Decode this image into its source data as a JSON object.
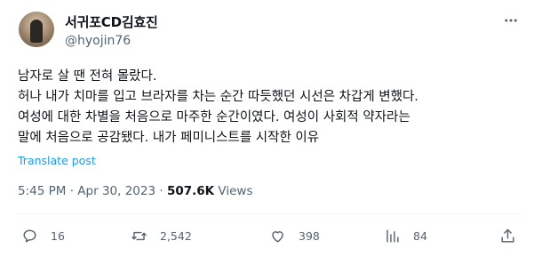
{
  "author": {
    "display_name": "서귀포CD김효진",
    "handle": "@hyojin76"
  },
  "tweet": {
    "lines": [
      "남자로 살 땐 전혀 몰랐다.",
      "허나 내가 치마를 입고 브라자를 차는 순간 따듯했던 시선은 차갑게 변했다.",
      "여성에 대한 차별을 처음으로 마주한 순간이였다. 여성이 사회적 약자라는",
      "말에 처음으로 공감됐다. 내가 페미니스트를 시작한 이유"
    ],
    "translate_label": "Translate post"
  },
  "meta": {
    "time": "5:45 PM",
    "separator": "·",
    "date": "Apr 30, 2023",
    "views_count": "507.6K",
    "views_label": "Views"
  },
  "actions": {
    "replies": "16",
    "reposts": "2,542",
    "likes": "398",
    "bookmarks": "84"
  },
  "icons": [
    "more-icon",
    "reply-icon",
    "repost-icon",
    "like-icon",
    "bookmark-icon",
    "share-icon"
  ],
  "colors": {
    "link": "#1d9bf0",
    "secondary": "#536471",
    "text": "#0f1419"
  }
}
